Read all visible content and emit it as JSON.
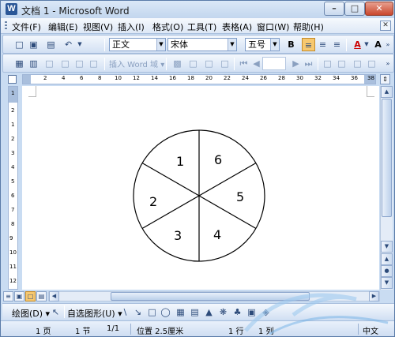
{
  "window": {
    "title": "文档 1 - Microsoft Word",
    "app_icon": "W",
    "controls": {
      "minimize": "–",
      "maximize": "□",
      "close": "✕"
    }
  },
  "menubar": {
    "items": [
      "文件(F)",
      "编辑(E)",
      "视图(V)",
      "插入(I)",
      "格式(O)",
      "工具(T)",
      "表格(A)",
      "窗口(W)",
      "帮助(H)"
    ],
    "doc_restore": "✕"
  },
  "toolbar_formatting": {
    "style_value": "正文",
    "font_value": "宋体",
    "size_value": "五号",
    "bold_label": "B",
    "font_color_label": "A",
    "grow_font_label": "A"
  },
  "toolbar_reviewing": {
    "insert_word_label": "插入 Word 域 ▾"
  },
  "ruler": {
    "h_numbers": [
      "2",
      "4",
      "6",
      "8",
      "10",
      "12",
      "14",
      "16",
      "18",
      "20",
      "22",
      "24",
      "26",
      "28",
      "30",
      "32",
      "34",
      "36",
      "38"
    ],
    "v_numbers": [
      "1",
      "2",
      "1",
      "2",
      "3",
      "4",
      "5",
      "6",
      "7",
      "8",
      "9",
      "10",
      "11",
      "12"
    ]
  },
  "document": {
    "sector_labels": [
      "1",
      "6",
      "2",
      "5",
      "3",
      "4"
    ]
  },
  "drawing_toolbar": {
    "draw_label": "绘图(D) ▾",
    "autoshapes_label": "自选图形(U) ▾"
  },
  "statusbar": {
    "page": "1 页",
    "section": "1 节",
    "page_of": "1/1",
    "position": "位置 2.5厘米",
    "line": "1 行",
    "column": "1 列",
    "language": "中文"
  },
  "colors": {
    "titlebar": "#c2d6ee",
    "toolbar": "#d2e0f3",
    "close_button": "#c9462c",
    "pressed_button": "#f7c86f"
  }
}
